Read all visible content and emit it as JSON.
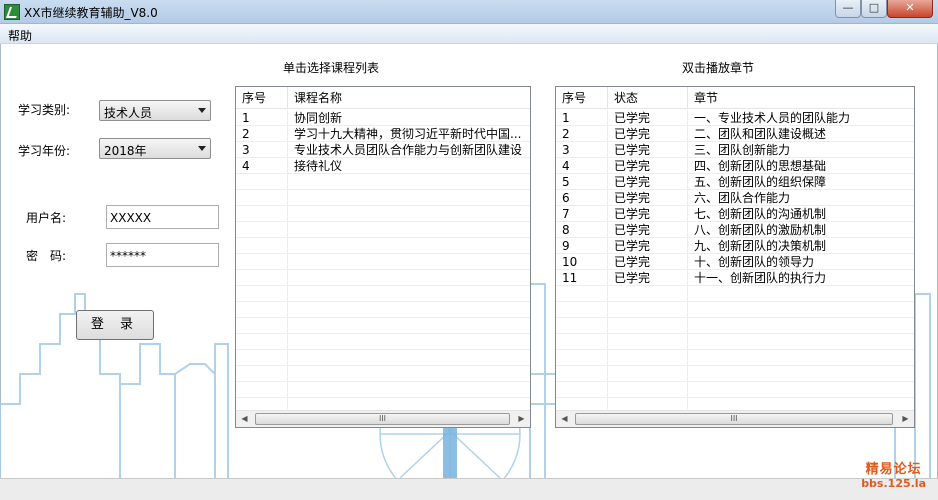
{
  "window": {
    "title": "XX市继续教育辅助_V8.0",
    "minimize": "—",
    "maximize": "□",
    "close": "✕"
  },
  "menu": {
    "help": "帮助"
  },
  "form": {
    "category_label": "学习类别:",
    "category_value": "技术人员",
    "year_label": "学习年份:",
    "year_value": "2018年",
    "username_label": "用户名:",
    "username_value": "XXXXX",
    "password_label": "密　码:",
    "password_value": "******",
    "login_button": "登 录"
  },
  "course_list": {
    "heading": "单击选择课程列表",
    "columns": [
      "序号",
      "课程名称"
    ],
    "rows": [
      [
        "1",
        "协同创新"
      ],
      [
        "2",
        "学习十九大精神，贯彻习近平新时代中国..."
      ],
      [
        "3",
        "专业技术人员团队合作能力与创新团队建设"
      ],
      [
        "4",
        "接待礼仪"
      ]
    ]
  },
  "chapter_list": {
    "heading": "双击播放章节",
    "columns": [
      "序号",
      "状态",
      "章节"
    ],
    "rows": [
      [
        "1",
        "已学完",
        "一、专业技术人员的团队能力"
      ],
      [
        "2",
        "已学完",
        "二、团队和团队建设概述"
      ],
      [
        "3",
        "已学完",
        "三、团队创新能力"
      ],
      [
        "4",
        "已学完",
        "四、创新团队的思想基础"
      ],
      [
        "5",
        "已学完",
        "五、创新团队的组织保障"
      ],
      [
        "6",
        "已学完",
        "六、团队合作能力"
      ],
      [
        "7",
        "已学完",
        "七、创新团队的沟通机制"
      ],
      [
        "8",
        "已学完",
        "八、创新团队的激励机制"
      ],
      [
        "9",
        "已学完",
        "九、创新团队的决策机制"
      ],
      [
        "10",
        "已学完",
        "十、创新团队的领导力"
      ],
      [
        "11",
        "已学完",
        "十一、创新团队的执行力"
      ]
    ]
  },
  "scrollbar": {
    "left_arrow": "◀",
    "right_arrow": "▶",
    "thumb": "III"
  },
  "watermark": {
    "line1": "精易论坛",
    "line2": "bbs.125.la"
  },
  "colors": {
    "skyline": "#a8cde8",
    "watermark": "#e05a1e",
    "close": "#c7452c"
  }
}
